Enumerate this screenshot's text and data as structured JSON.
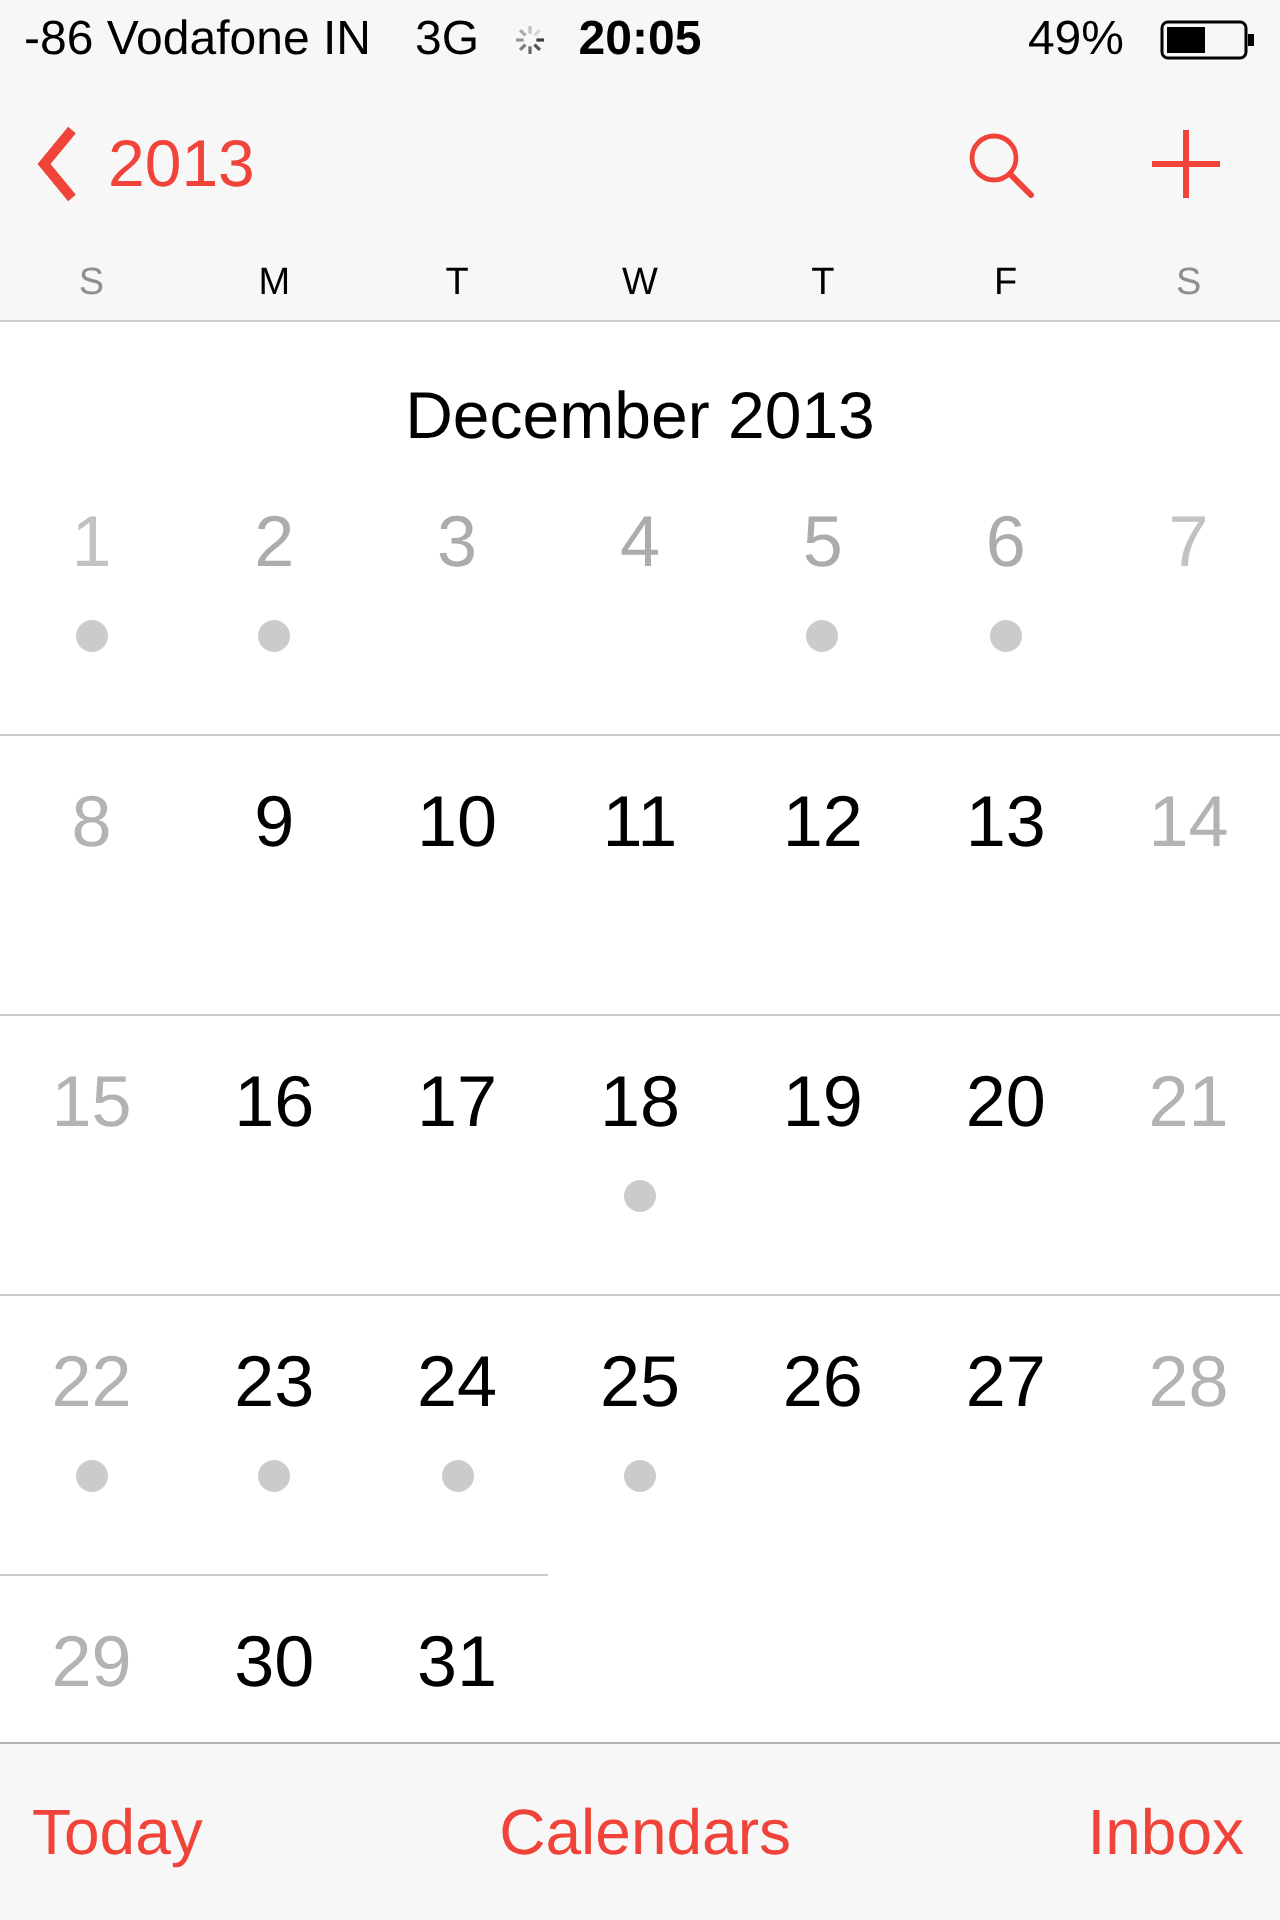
{
  "status_bar": {
    "carrier": "-86 Vodafone IN",
    "network": "3G",
    "time": "20:05",
    "battery_percent": "49%"
  },
  "nav_bar": {
    "back_label": "2013"
  },
  "weekdays": [
    {
      "label": "S",
      "weekend": true
    },
    {
      "label": "M",
      "weekend": false
    },
    {
      "label": "T",
      "weekend": false
    },
    {
      "label": "W",
      "weekend": false
    },
    {
      "label": "T",
      "weekend": false
    },
    {
      "label": "F",
      "weekend": false
    },
    {
      "label": "S",
      "weekend": true
    }
  ],
  "month": {
    "title": "December 2013",
    "weeks": [
      {
        "faded": true,
        "days": [
          {
            "number": "1",
            "weekend": true,
            "event": true
          },
          {
            "number": "2",
            "weekend": false,
            "event": true
          },
          {
            "number": "3",
            "weekend": false,
            "event": false
          },
          {
            "number": "4",
            "weekend": false,
            "event": false
          },
          {
            "number": "5",
            "weekend": false,
            "event": true
          },
          {
            "number": "6",
            "weekend": false,
            "event": true
          },
          {
            "number": "7",
            "weekend": true,
            "event": false
          }
        ]
      },
      {
        "faded": false,
        "days": [
          {
            "number": "8",
            "weekend": true,
            "event": false
          },
          {
            "number": "9",
            "weekend": false,
            "event": false
          },
          {
            "number": "10",
            "weekend": false,
            "event": false
          },
          {
            "number": "11",
            "weekend": false,
            "event": false
          },
          {
            "number": "12",
            "weekend": false,
            "event": false
          },
          {
            "number": "13",
            "weekend": false,
            "event": false
          },
          {
            "number": "14",
            "weekend": true,
            "event": false
          }
        ]
      },
      {
        "faded": false,
        "days": [
          {
            "number": "15",
            "weekend": true,
            "event": false
          },
          {
            "number": "16",
            "weekend": false,
            "event": false
          },
          {
            "number": "17",
            "weekend": false,
            "event": false
          },
          {
            "number": "18",
            "weekend": false,
            "event": true
          },
          {
            "number": "19",
            "weekend": false,
            "event": false
          },
          {
            "number": "20",
            "weekend": false,
            "event": false
          },
          {
            "number": "21",
            "weekend": true,
            "event": false
          }
        ]
      },
      {
        "faded": false,
        "days": [
          {
            "number": "22",
            "weekend": true,
            "event": true
          },
          {
            "number": "23",
            "weekend": false,
            "event": true
          },
          {
            "number": "24",
            "weekend": false,
            "event": true
          },
          {
            "number": "25",
            "weekend": false,
            "event": true
          },
          {
            "number": "26",
            "weekend": false,
            "event": false
          },
          {
            "number": "27",
            "weekend": false,
            "event": false
          },
          {
            "number": "28",
            "weekend": true,
            "event": false
          }
        ]
      },
      {
        "faded": false,
        "days": [
          {
            "number": "29",
            "weekend": true,
            "event": false
          },
          {
            "number": "30",
            "weekend": false,
            "event": false
          },
          {
            "number": "31",
            "weekend": false,
            "event": false
          }
        ]
      }
    ]
  },
  "toolbar": {
    "buttons": [
      "Today",
      "Calendars",
      "Inbox"
    ]
  }
}
